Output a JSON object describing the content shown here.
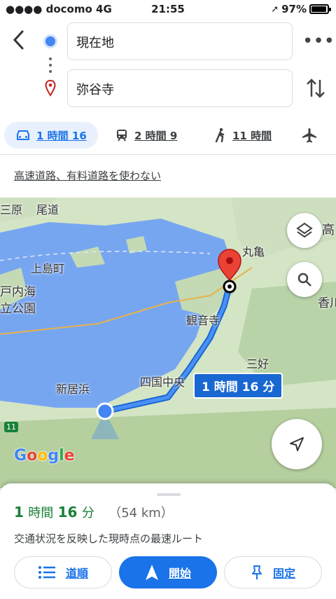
{
  "status_bar": {
    "carrier": "docomo",
    "network": "4G",
    "time": "21:55",
    "battery": "97%"
  },
  "header": {
    "origin": "現在地",
    "destination": "弥谷寺",
    "more_label": "•••"
  },
  "modes": [
    {
      "icon": "car-icon",
      "label": "1 時間 16",
      "active": true
    },
    {
      "icon": "transit-icon",
      "label": "2 時間 9",
      "active": false
    },
    {
      "icon": "walk-icon",
      "label": "11 時間",
      "active": false
    },
    {
      "icon": "flight-icon",
      "label": "",
      "active": false
    }
  ],
  "route_option_link": "高速道路、有料道路を使わない",
  "map": {
    "labels": {
      "sanbara": "三原",
      "onomichi": "尾道",
      "kamijima": "上島町",
      "setonaikai": "戸内海",
      "ritsukoen": "立公園",
      "marugame": "丸亀",
      "kanonji": "観音寺",
      "miyoshi": "三好",
      "niihama": "新居浜",
      "shikokuchuo": "四国中央",
      "taka": "高",
      "kagawa": "香川県",
      "route_11": "11"
    },
    "eta_bubble": "1 時間 16 分",
    "google_logo": [
      "G",
      "o",
      "o",
      "g",
      "l",
      "e"
    ],
    "colors": {
      "sea": "#77a6f1",
      "land": "#d4e5c6",
      "route": "#4285f4",
      "accent": "#1a73e8"
    }
  },
  "sheet": {
    "duration_h": "1",
    "duration_h_unit": "時間",
    "duration_m": "16",
    "duration_m_unit": "分",
    "distance": "（54 km）",
    "subtext": "交通状況を反映した現時点の最速ルート",
    "buttons": {
      "steps": "道順",
      "start": "開始",
      "pin": "固定"
    }
  }
}
